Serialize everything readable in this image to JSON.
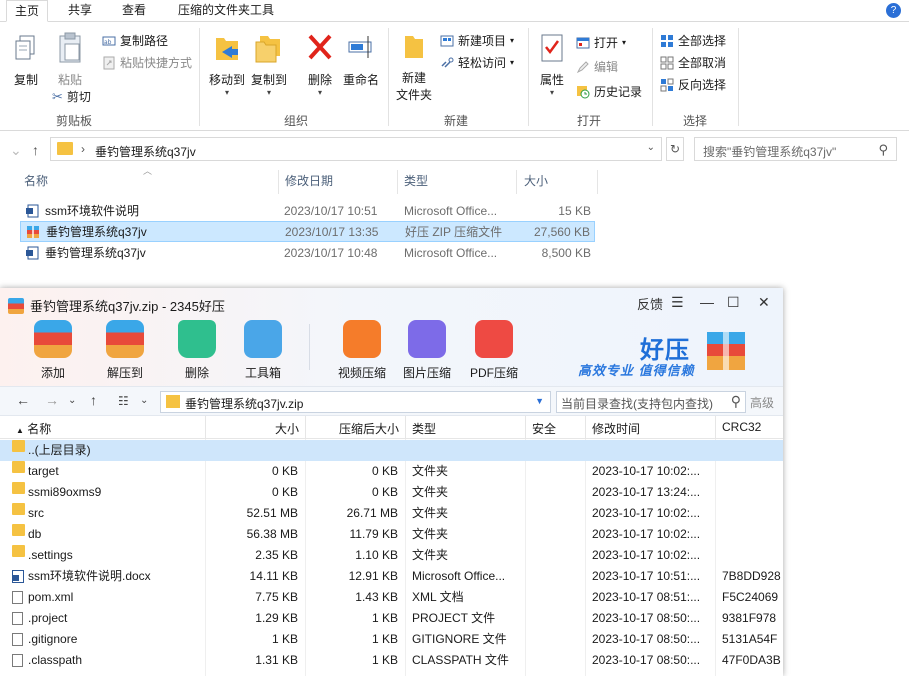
{
  "explorer": {
    "tabs": [
      "主页",
      "共享",
      "查看",
      "压缩的文件夹工具"
    ],
    "ribbon": {
      "clipboard": {
        "copy": "复制",
        "paste": "粘贴",
        "copy_path": "复制路径",
        "paste_shortcut": "粘贴快捷方式",
        "cut": "剪切",
        "group": "剪贴板"
      },
      "organize": {
        "move_to": "移动到",
        "copy_to": "复制到",
        "delete": "删除",
        "rename": "重命名",
        "group": "组织"
      },
      "new": {
        "new_folder_1": "新建",
        "new_folder_2": "文件夹",
        "new_item": "新建项目",
        "easy_access": "轻松访问",
        "group": "新建"
      },
      "open": {
        "properties": "属性",
        "open": "打开",
        "edit": "编辑",
        "history": "历史记录",
        "group": "打开"
      },
      "select": {
        "select_all": "全部选择",
        "select_none": "全部取消",
        "invert": "反向选择",
        "group": "选择"
      }
    },
    "address": {
      "path": "垂钓管理系统q37jv",
      "search_placeholder": "搜索\"垂钓管理系统q37jv\""
    },
    "columns": {
      "name": "名称",
      "date": "修改日期",
      "type": "类型",
      "size": "大小"
    },
    "files": [
      {
        "name": "ssm环境软件说明",
        "date": "2023/10/17 10:51",
        "type": "Microsoft Office...",
        "size": "15 KB",
        "icon": "word-icon"
      },
      {
        "name": "垂钓管理系统q37jv",
        "date": "2023/10/17 13:35",
        "type": "好压 ZIP 压缩文件",
        "size": "27,560 KB",
        "icon": "zip-icon"
      },
      {
        "name": "垂钓管理系统q37jv",
        "date": "2023/10/17 10:48",
        "type": "Microsoft Office...",
        "size": "8,500 KB",
        "icon": "word-icon"
      }
    ]
  },
  "haozip": {
    "title": "垂钓管理系统q37jv.zip - 2345好压",
    "feedback": "反馈",
    "toolbar": [
      "添加",
      "解压到",
      "删除",
      "工具箱",
      "视频压缩",
      "图片压缩",
      "PDF压缩"
    ],
    "brand": "好压",
    "slogan": "高效专业  值得信赖",
    "path": "垂钓管理系统q37jv.zip",
    "search_placeholder": "当前目录查找(支持包内查找)",
    "advanced": "高级",
    "columns": {
      "name": "名称",
      "size": "大小",
      "compressed": "压缩后大小",
      "type": "类型",
      "security": "安全",
      "modified": "修改时间",
      "crc": "CRC32"
    },
    "rows": [
      {
        "name": "..(上层目录)",
        "size": "",
        "csize": "",
        "type": "",
        "mtime": "",
        "crc": "",
        "kind": "folder"
      },
      {
        "name": "target",
        "size": "0 KB",
        "csize": "0 KB",
        "type": "文件夹",
        "mtime": "2023-10-17 10:02:...",
        "crc": "",
        "kind": "folder"
      },
      {
        "name": "ssmi89oxms9",
        "size": "0 KB",
        "csize": "0 KB",
        "type": "文件夹",
        "mtime": "2023-10-17 13:24:...",
        "crc": "",
        "kind": "folder"
      },
      {
        "name": "src",
        "size": "52.51 MB",
        "csize": "26.71 MB",
        "type": "文件夹",
        "mtime": "2023-10-17 10:02:...",
        "crc": "",
        "kind": "folder"
      },
      {
        "name": "db",
        "size": "56.38 MB",
        "csize": "11.79 KB",
        "type": "文件夹",
        "mtime": "2023-10-17 10:02:...",
        "crc": "",
        "kind": "folder"
      },
      {
        "name": ".settings",
        "size": "2.35 KB",
        "csize": "1.10 KB",
        "type": "文件夹",
        "mtime": "2023-10-17 10:02:...",
        "crc": "",
        "kind": "folder"
      },
      {
        "name": "ssm环境软件说明.docx",
        "size": "14.11 KB",
        "csize": "12.91 KB",
        "type": "Microsoft Office...",
        "mtime": "2023-10-17 10:51:...",
        "crc": "7B8DD928",
        "kind": "doc"
      },
      {
        "name": "pom.xml",
        "size": "7.75 KB",
        "csize": "1.43 KB",
        "type": "XML 文档",
        "mtime": "2023-10-17 08:51:...",
        "crc": "F5C24069",
        "kind": "file"
      },
      {
        "name": ".project",
        "size": "1.29 KB",
        "csize": "1 KB",
        "type": "PROJECT 文件",
        "mtime": "2023-10-17 08:50:...",
        "crc": "9381F978",
        "kind": "file"
      },
      {
        "name": ".gitignore",
        "size": "1 KB",
        "csize": "1 KB",
        "type": "GITIGNORE 文件",
        "mtime": "2023-10-17 08:50:...",
        "crc": "5131A54F",
        "kind": "file"
      },
      {
        "name": ".classpath",
        "size": "1.31 KB",
        "csize": "1 KB",
        "type": "CLASSPATH 文件",
        "mtime": "2023-10-17 08:50:...",
        "crc": "47F0DA3B",
        "kind": "file"
      }
    ]
  }
}
